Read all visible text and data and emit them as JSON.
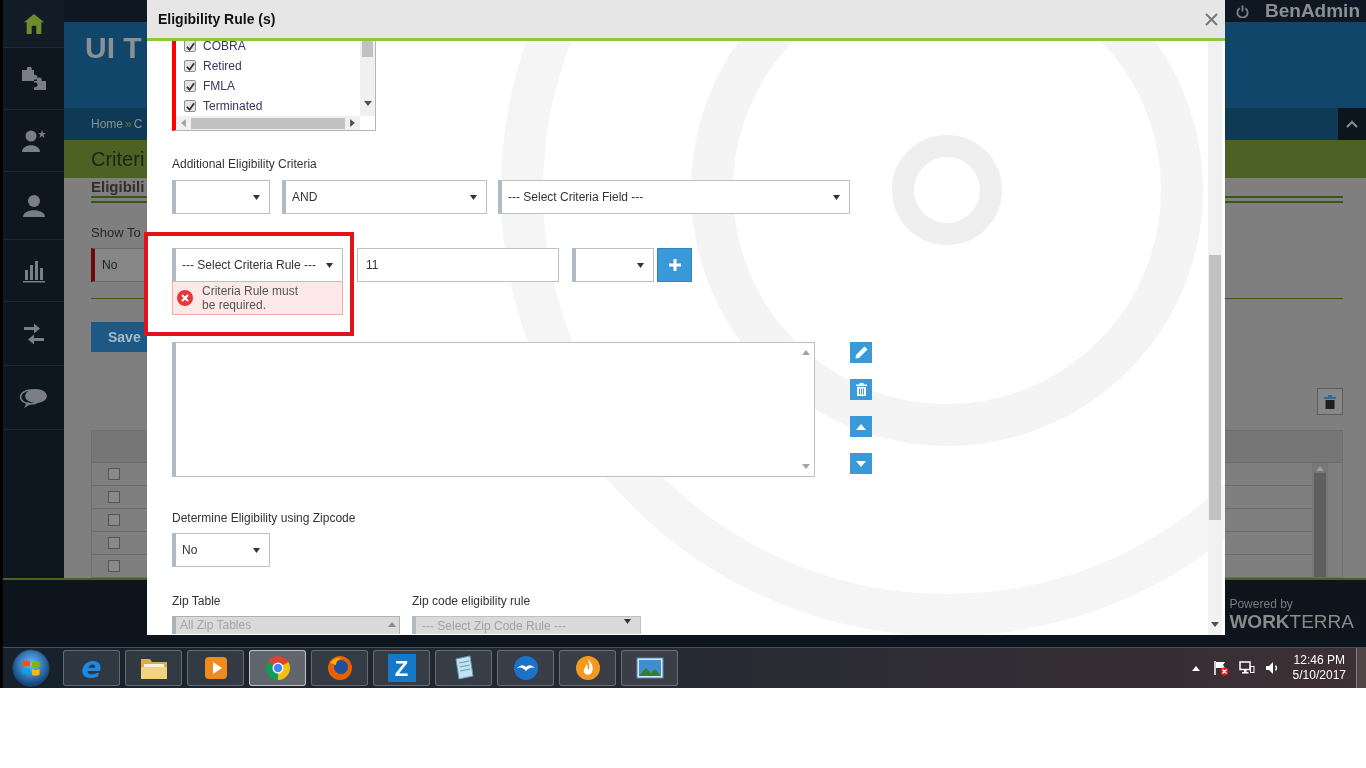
{
  "background_page": {
    "top_bar": {
      "user_name": "BenAdmin"
    },
    "header": {
      "title": "UI T"
    },
    "sidebar": {
      "items": [
        {
          "selected": true
        },
        {
          "selected": false
        },
        {
          "selected": false
        },
        {
          "selected": false
        },
        {
          "selected": false
        },
        {
          "selected": false
        },
        {
          "selected": false
        }
      ]
    },
    "breadcrumb": {
      "home": "Home",
      "separator": "»",
      "current": "C"
    },
    "page_title": "Criteri",
    "section_heading": "Eligibili",
    "show_to": {
      "label": "Show To",
      "value": "No"
    },
    "save_button": "Save",
    "table": {
      "rows": [
        {
          "checked": false
        },
        {
          "checked": false
        },
        {
          "checked": false
        },
        {
          "checked": false
        },
        {
          "checked": false
        }
      ]
    },
    "footer": {
      "powered_by": "Powered by",
      "brand": "**WORK**TERRA"
    }
  },
  "modal": {
    "title": "Eligibility Rule (s)",
    "status_list": {
      "items": [
        {
          "label": "COBRA",
          "checked": true
        },
        {
          "label": "Retired",
          "checked": true
        },
        {
          "label": "FMLA",
          "checked": true
        },
        {
          "label": "Terminated",
          "checked": true
        }
      ]
    },
    "additional_criteria": {
      "label": "Additional Eligibility Criteria",
      "operator_select": {
        "value": "AND"
      },
      "field_select": {
        "value": "--- Select Criteria Field ---"
      }
    },
    "criteria_rule": {
      "select": {
        "value": "--- Select Criteria Rule ---"
      },
      "error": "Criteria Rule must be required.",
      "value_input": {
        "value": "11"
      }
    },
    "zipcode_eligibility": {
      "label": "Determine Eligibility using Zipcode",
      "value": "No"
    },
    "zip_table": {
      "label": "Zip Table",
      "option": "All Zip Tables",
      "disabled": true
    },
    "zip_rule": {
      "label": "Zip code eligibility rule",
      "value": "--- Select Zip Code Rule ---",
      "disabled": true
    }
  },
  "taskbar": {
    "apps": [
      {
        "glyph": "e",
        "selected": false
      },
      {
        "selected": false
      },
      {
        "selected": false
      },
      {
        "selected": true
      },
      {
        "selected": false
      },
      {
        "glyph": "Z",
        "selected": false
      },
      {
        "selected": false
      },
      {
        "selected": false
      },
      {
        "selected": false
      },
      {
        "selected": false
      }
    ],
    "clock": {
      "time": "12:46 PM",
      "date": "5/10/2017"
    }
  }
}
